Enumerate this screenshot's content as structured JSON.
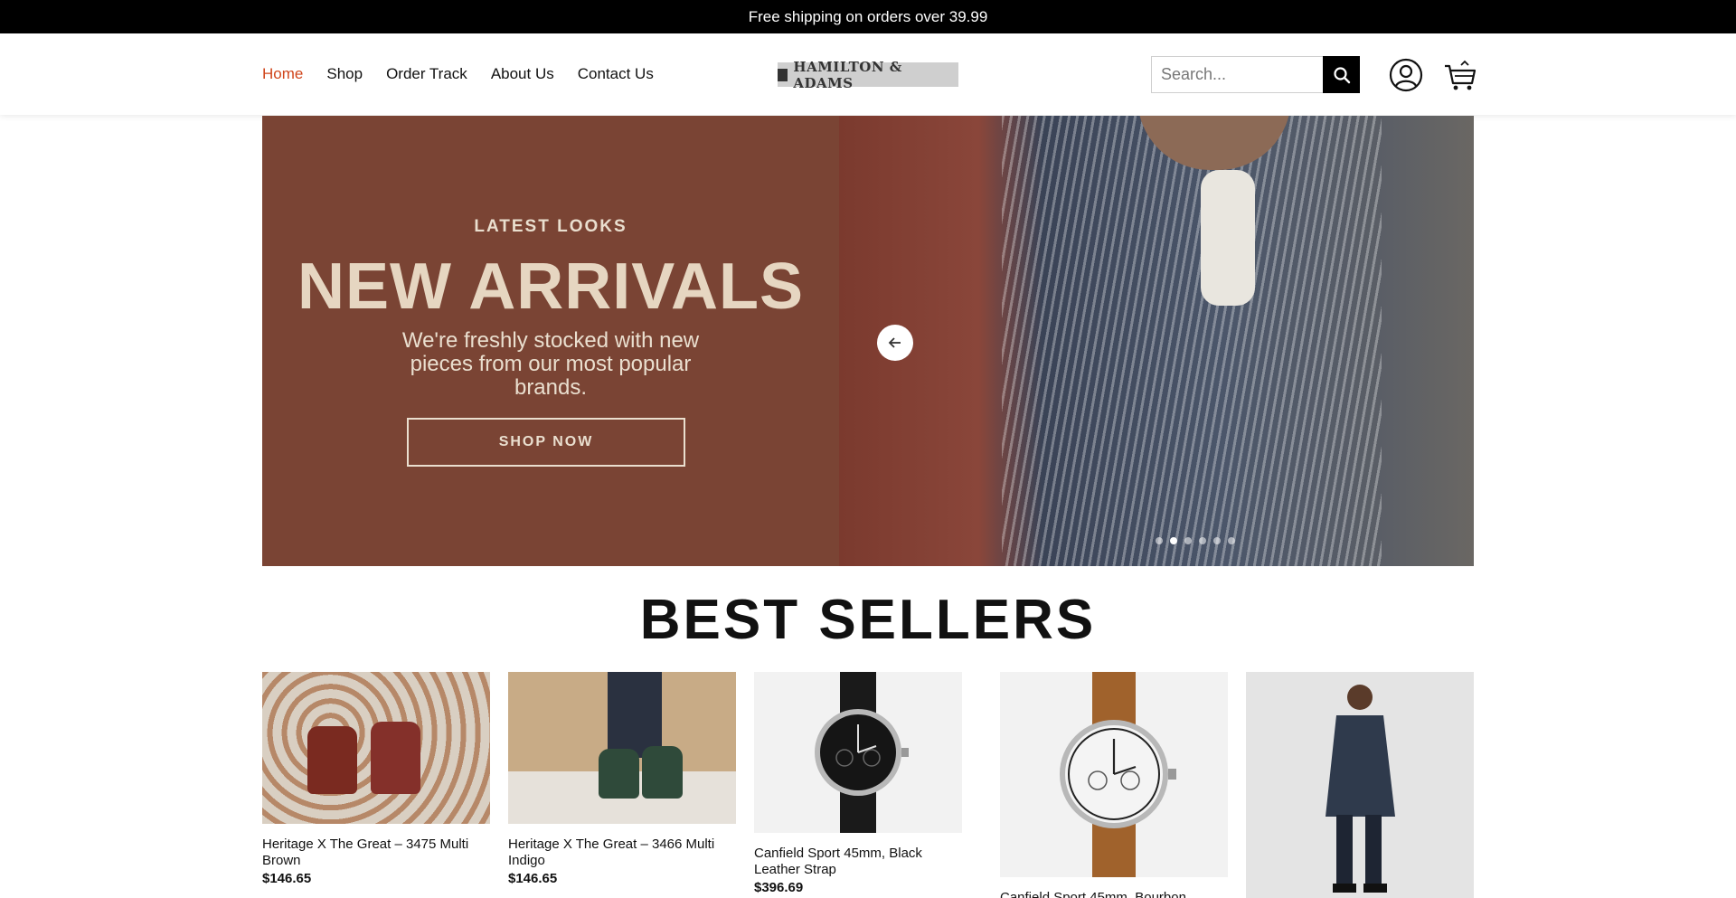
{
  "announcement": {
    "text": "Free shipping on orders over 39.99"
  },
  "nav": {
    "items": [
      {
        "label": "Home",
        "active": true
      },
      {
        "label": "Shop",
        "active": false
      },
      {
        "label": "Order Track",
        "active": false
      },
      {
        "label": "About Us",
        "active": false
      },
      {
        "label": "Contact Us",
        "active": false
      }
    ],
    "active_color": "#d0451b"
  },
  "logo": {
    "text": "HAMILTON & ADAMS"
  },
  "search": {
    "placeholder": "Search...",
    "icon": "search-icon"
  },
  "header_icons": {
    "account": "user-circle-icon",
    "cart": "cart-icon"
  },
  "hero": {
    "eyebrow": "LATEST LOOKS",
    "headline": "NEW ARRIVALS",
    "subtext": "We're freshly stocked with new pieces from our most popular brands.",
    "cta": "SHOP NOW",
    "prev_icon": "arrow-left-icon",
    "slide_count": 6,
    "active_slide": 2,
    "panel_color": "#7a4434"
  },
  "best_sellers": {
    "title": "BEST SELLERS",
    "products": [
      {
        "name": "Heritage X The Great – 3475 Multi Brown",
        "price": "$146.65"
      },
      {
        "name": "Heritage X The Great – 3466 Multi Indigo",
        "price": "$146.65"
      },
      {
        "name": "Canfield Sport 45mm, Black Leather Strap",
        "price": "$396.69"
      },
      {
        "name": "Canfield Sport 45mm, Bourbon",
        "price": ""
      },
      {
        "name": "",
        "price": ""
      }
    ]
  }
}
